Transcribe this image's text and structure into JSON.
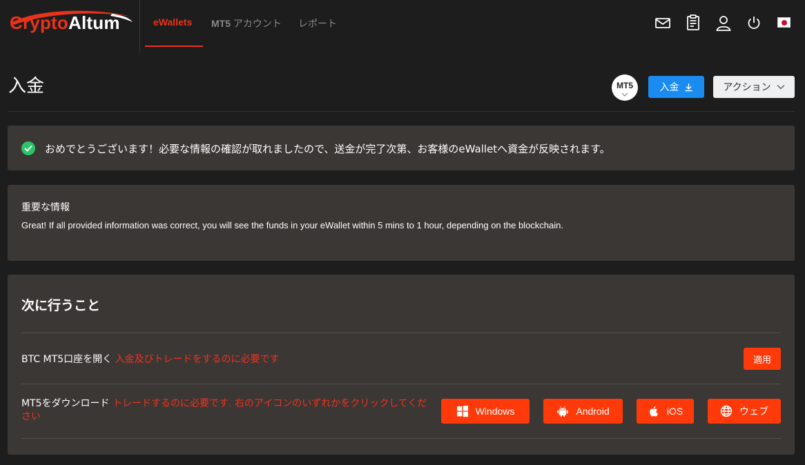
{
  "brand": {
    "logo_part1": "Crypto",
    "logo_part2": "Altum"
  },
  "nav": {
    "tabs": [
      {
        "label": "eWallets",
        "active": true
      },
      {
        "label_bold": "MT5",
        "label_rest": " アカウント",
        "active": false
      },
      {
        "label": "レポート",
        "active": false
      }
    ],
    "icons": [
      "mail-icon",
      "clipboard-icon",
      "user-icon",
      "power-icon",
      "japan-flag-icon"
    ]
  },
  "header": {
    "title": "入金",
    "platform_badge": "MT5",
    "deposit_button": "入金",
    "actions_button": "アクション"
  },
  "success_alert": {
    "message": "おめでとうございます！必要な情報の確認が取れましたので、送金が完了次第、お客様のeWalletへ資金が反映されます。"
  },
  "important_info": {
    "title": "重要な情報",
    "body": "Great! If all provided information was correct, you will see the funds in your eWallet within 5 mins to 1 hour, depending on the blockchain."
  },
  "next_steps": {
    "title": "次に行うこと",
    "step1": {
      "label": "BTC MT5口座を開く",
      "note": "入金及びトレードをするのに必要です",
      "button": "適用"
    },
    "step2": {
      "label": "MT5をダウンロード",
      "note": "トレードするのに必要です. 右のアイコンのいずれかをクリックしてください",
      "buttons": {
        "windows": "Windows",
        "android": "Android",
        "ios": "iOS",
        "web": "ウェブ"
      }
    }
  },
  "colors": {
    "background": "#1e1d1d",
    "panel": "#3b3735",
    "accent_red": "#e8331c",
    "button_red": "#ff3a0a",
    "deposit_blue": "#1a8cf0",
    "success_green": "#2cc36b"
  }
}
